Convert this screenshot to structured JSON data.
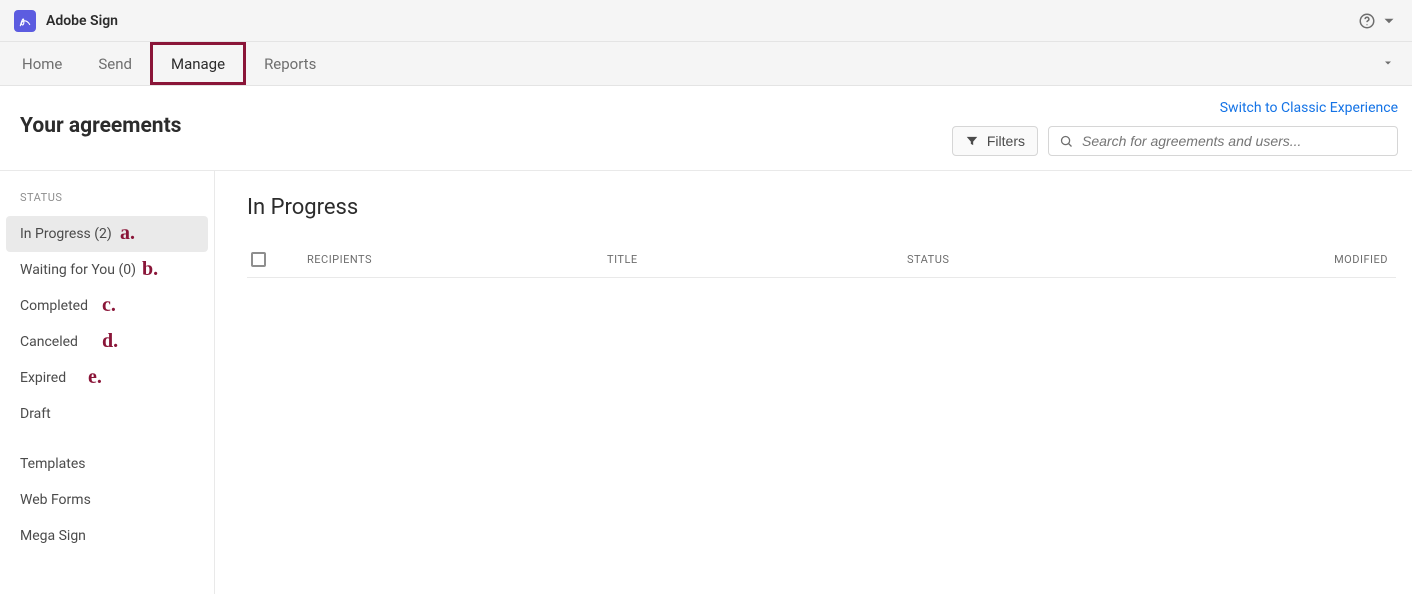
{
  "app": {
    "name": "Adobe Sign"
  },
  "nav": {
    "items": [
      {
        "label": "Home",
        "active": false
      },
      {
        "label": "Send",
        "active": false
      },
      {
        "label": "Manage",
        "active": true
      },
      {
        "label": "Reports",
        "active": false
      }
    ]
  },
  "header": {
    "page_title": "Your agreements",
    "classic_link": "Switch to Classic Experience",
    "filters_label": "Filters",
    "search_placeholder": "Search for agreements and users..."
  },
  "sidebar": {
    "status_heading": "STATUS",
    "status_items": [
      {
        "label": "In Progress (2)",
        "selected": true,
        "annot": "a."
      },
      {
        "label": "Waiting for You (0)",
        "selected": false,
        "annot": "b."
      },
      {
        "label": "Completed",
        "selected": false,
        "annot": "c."
      },
      {
        "label": "Canceled",
        "selected": false,
        "annot": "d."
      },
      {
        "label": "Expired",
        "selected": false,
        "annot": "e."
      },
      {
        "label": "Draft",
        "selected": false,
        "annot": ""
      }
    ],
    "other_items": [
      {
        "label": "Templates"
      },
      {
        "label": "Web Forms"
      },
      {
        "label": "Mega Sign"
      }
    ]
  },
  "content": {
    "title": "In Progress",
    "columns": {
      "recipients": "RECIPIENTS",
      "title": "TITLE",
      "status": "STATUS",
      "modified": "MODIFIED"
    }
  }
}
